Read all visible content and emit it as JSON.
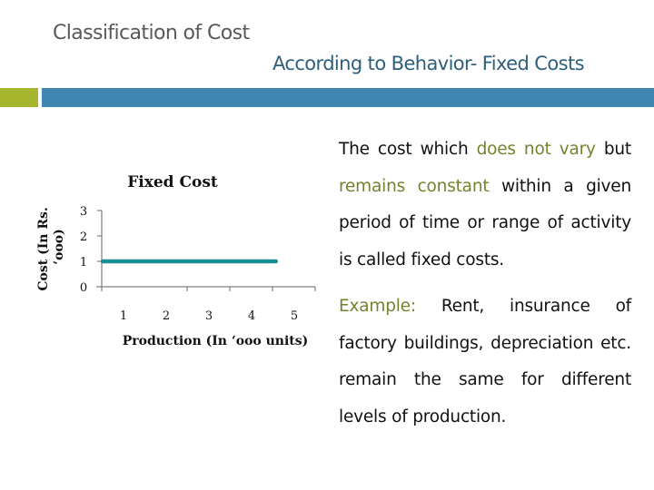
{
  "slide": {
    "title": "Classification of Cost",
    "subtitle": "According to Behavior- Fixed Costs",
    "accent_colors": {
      "green": "#a5b52d",
      "blue": "#3f87b0",
      "highlight_text": "#76812e",
      "subtitle_text": "#2e5f7a"
    }
  },
  "body": {
    "paragraph1": [
      {
        "text": "The cost which ",
        "highlight": false
      },
      {
        "text": "does not vary",
        "highlight": true
      },
      {
        "text": " but ",
        "highlight": false
      },
      {
        "text": "remains constant",
        "highlight": true
      },
      {
        "text": " within a given period of time or range of activity is called fixed costs.",
        "highlight": false
      }
    ],
    "paragraph2": [
      {
        "text": "Example:",
        "highlight": true
      },
      {
        "text": " Rent, insurance of factory buildings, depreciation etc. remain the same for different levels of production.",
        "highlight": false
      }
    ]
  },
  "chart_data": {
    "type": "line",
    "title": "Fixed Cost",
    "xlabel": "Production (In ‘ooo units)",
    "ylabel": "Cost (In Rs. ‘ooo)",
    "x_categories": [
      "1",
      "2",
      "3",
      "4",
      "5"
    ],
    "y_ticks": [
      "0",
      "1",
      "2",
      "3"
    ],
    "ylim": [
      0,
      3
    ],
    "grid": false,
    "legend": "none",
    "series": [
      {
        "name": "Fixed Cost",
        "color": "#1a8f91",
        "x_start": 0,
        "x_end": 4.1,
        "value": 1
      }
    ]
  }
}
